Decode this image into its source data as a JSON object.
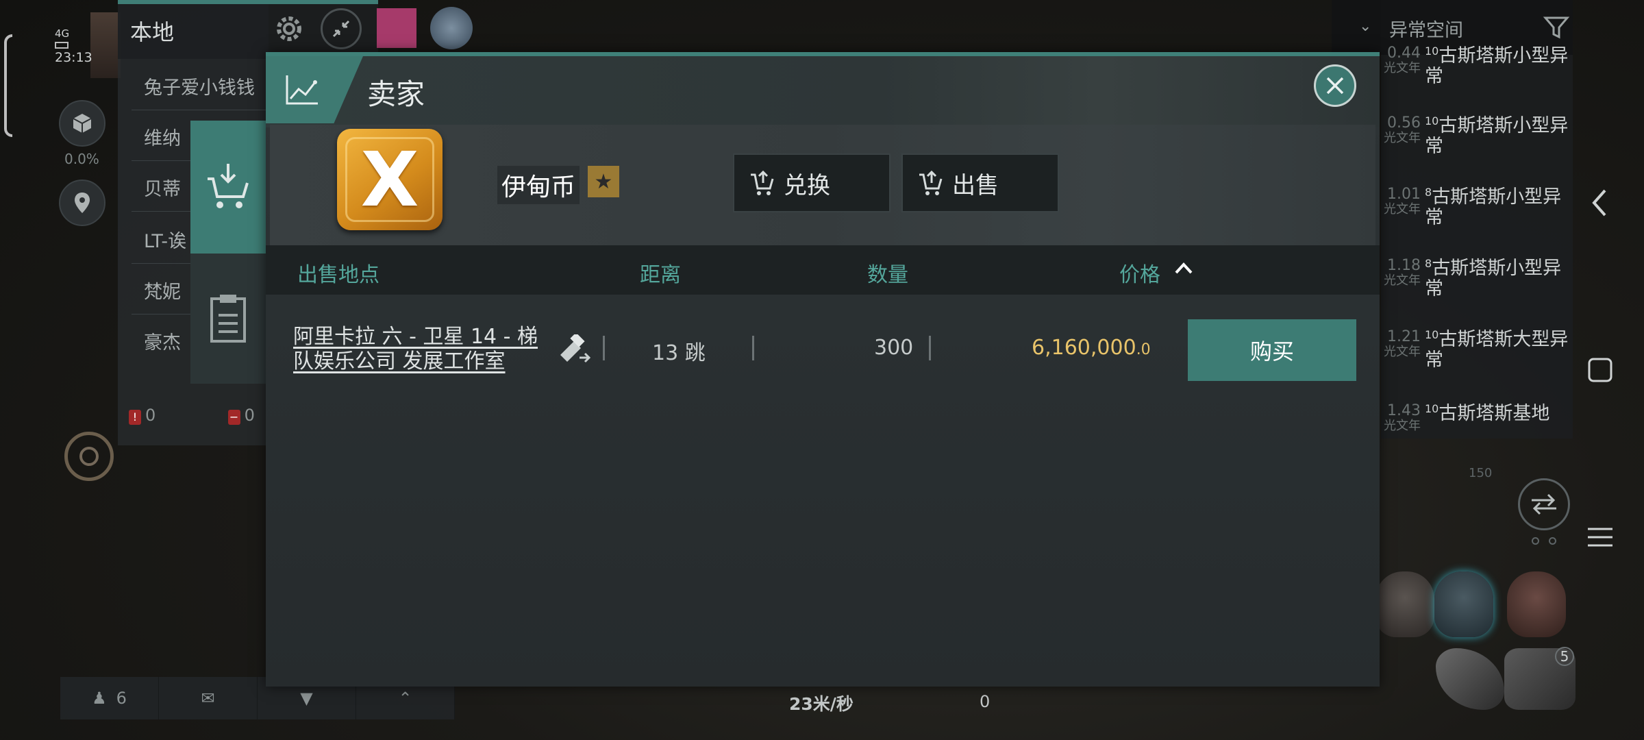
{
  "status": {
    "signal": "4G",
    "time": "23:13"
  },
  "hud": {
    "percent": "0.0%"
  },
  "local_chat": {
    "title": "本地",
    "members": [
      "兔子爱小钱钱",
      "维纳",
      "贝蒂",
      "LT-诶",
      "梵妮",
      "豪杰"
    ],
    "counters": {
      "alerts": "0",
      "blocked": "0"
    },
    "bottom_bar": {
      "member_count": "6"
    }
  },
  "anomaly_panel": {
    "header": "异常空间",
    "items": [
      {
        "dist": "0.44",
        "dist_unit": "光文年",
        "level": "10",
        "name": "古斯塔斯小型异常"
      },
      {
        "dist": "0.56",
        "dist_unit": "光文年",
        "level": "10",
        "name": "古斯塔斯小型异常"
      },
      {
        "dist": "1.01",
        "dist_unit": "光文年",
        "level": "8",
        "name": "古斯塔斯小型异常"
      },
      {
        "dist": "1.18",
        "dist_unit": "光文年",
        "level": "8",
        "name": "古斯塔斯小型异常"
      },
      {
        "dist": "1.21",
        "dist_unit": "光文年",
        "level": "10",
        "name": "古斯塔斯大型异常"
      },
      {
        "dist": "1.43",
        "dist_unit": "光文年",
        "level": "10",
        "name": "古斯塔斯基地"
      }
    ]
  },
  "flight": {
    "speed": "23米/秒",
    "value": "0",
    "scale": "150",
    "ship_count": "5"
  },
  "dialog": {
    "title": "卖家",
    "item": {
      "name": "伊甸币",
      "coin_letter": "X"
    },
    "buttons": {
      "exchange": "兑换",
      "sell": "出售"
    },
    "columns": {
      "location": "出售地点",
      "distance": "距离",
      "quantity": "数量",
      "price": "价格"
    },
    "sort": {
      "column": "price",
      "direction": "ascending"
    },
    "rows": [
      {
        "location": "阿里卡拉 六 - 卫星 14 - 梯队娱乐公司 发展工作室",
        "distance": "13 跳",
        "quantity": "300",
        "price": "6,160,000",
        "price_decimal": ".0",
        "buy_label": "购买"
      }
    ]
  },
  "colors": {
    "accent": "#3d7c74",
    "header_text": "#54a69b",
    "price": "#e9c46a"
  }
}
